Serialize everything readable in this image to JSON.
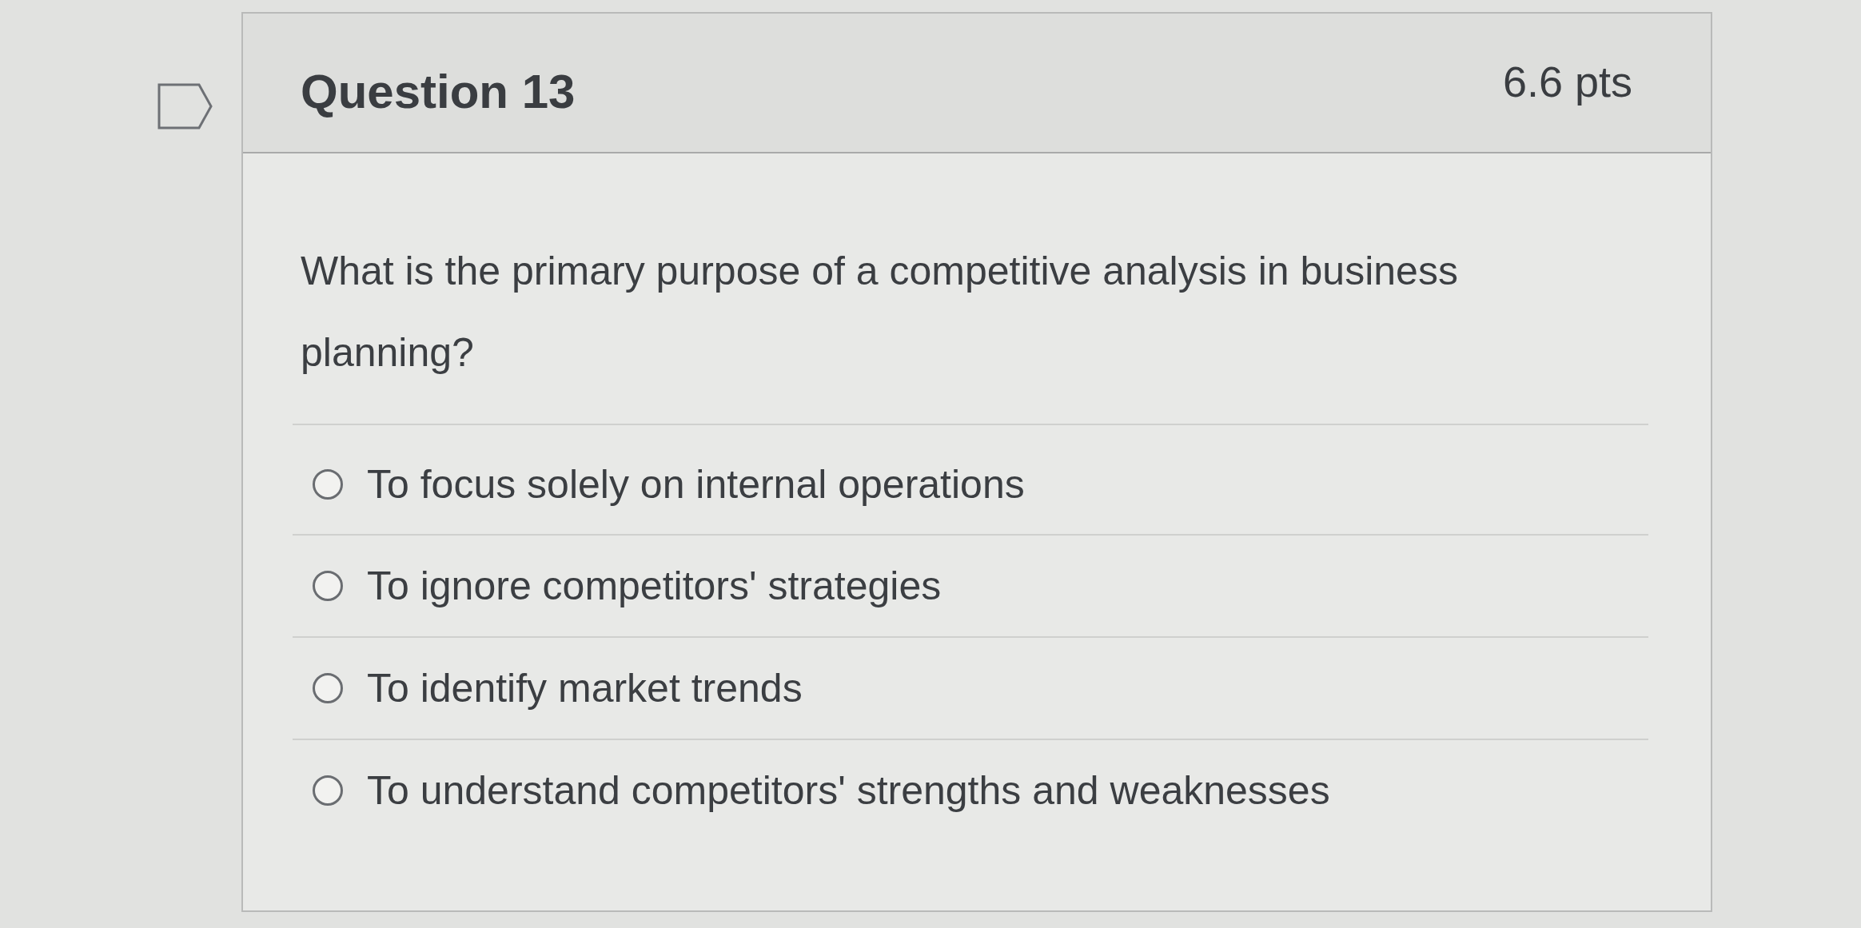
{
  "question": {
    "flagged": false,
    "title": "Question 13",
    "points": "6.6 pts",
    "text": "What is the primary purpose of a competitive analysis in business planning?"
  },
  "answers": [
    {
      "label": "To focus solely on internal operations",
      "selected": false
    },
    {
      "label": "To ignore competitors' strategies",
      "selected": false
    },
    {
      "label": "To identify market trends",
      "selected": false
    },
    {
      "label": "To understand competitors' strengths and weaknesses",
      "selected": false
    }
  ]
}
